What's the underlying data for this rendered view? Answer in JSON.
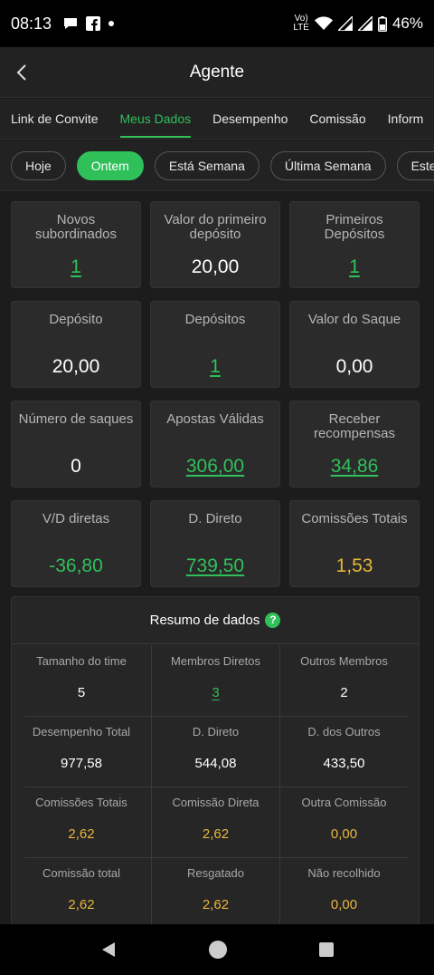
{
  "status": {
    "time": "08:13",
    "lte_top": "Vo)",
    "lte_bottom": "LTE",
    "battery": "46%"
  },
  "header": {
    "title": "Agente"
  },
  "tabs": [
    {
      "label": "Link de Convite"
    },
    {
      "label": "Meus Dados"
    },
    {
      "label": "Desempenho"
    },
    {
      "label": "Comissão"
    },
    {
      "label": "Inform"
    }
  ],
  "filters": [
    {
      "label": "Hoje"
    },
    {
      "label": "Ontem"
    },
    {
      "label": "Está Semana"
    },
    {
      "label": "Última Semana"
    },
    {
      "label": "Este Mês"
    }
  ],
  "cards": [
    {
      "label": "Novos subordinados",
      "value": "1"
    },
    {
      "label": "Valor do primeiro depósito",
      "value": "20,00"
    },
    {
      "label": "Primeiros Depósitos",
      "value": "1"
    },
    {
      "label": "Depósito",
      "value": "20,00"
    },
    {
      "label": "Depósitos",
      "value": "1"
    },
    {
      "label": "Valor do Saque",
      "value": "0,00"
    },
    {
      "label": "Número de saques",
      "value": "0"
    },
    {
      "label": "Apostas Válidas",
      "value": "306,00"
    },
    {
      "label": "Receber recompensas",
      "value": "34,86"
    },
    {
      "label": "V/D diretas",
      "value": "-36,80"
    },
    {
      "label": "D. Direto",
      "value": "739,50"
    },
    {
      "label": "Comissões Totais",
      "value": "1,53"
    }
  ],
  "summary": {
    "title": "Resumo de dados",
    "help_icon": "?",
    "rows": [
      [
        {
          "label": "Tamanho do time",
          "value": "5"
        },
        {
          "label": "Membros Diretos",
          "value": "3"
        },
        {
          "label": "Outros Membros",
          "value": "2"
        }
      ],
      [
        {
          "label": "Desempenho Total",
          "value": "977,58"
        },
        {
          "label": "D. Direto",
          "value": "544,08"
        },
        {
          "label": "D. dos Outros",
          "value": "433,50"
        }
      ],
      [
        {
          "label": "Comissões Totais",
          "value": "2,62"
        },
        {
          "label": "Comissão Direta",
          "value": "2,62"
        },
        {
          "label": "Outra Comissão",
          "value": "0,00"
        }
      ],
      [
        {
          "label": "Comissão total",
          "value": "2,62"
        },
        {
          "label": "Resgatado",
          "value": "2,62"
        },
        {
          "label": "Não recolhido",
          "value": "0,00"
        }
      ]
    ]
  },
  "colors": {
    "accent": "#2fc05a",
    "gold": "#e8b63c",
    "background": "#1c1c1c",
    "card": "#2b2b2b"
  }
}
